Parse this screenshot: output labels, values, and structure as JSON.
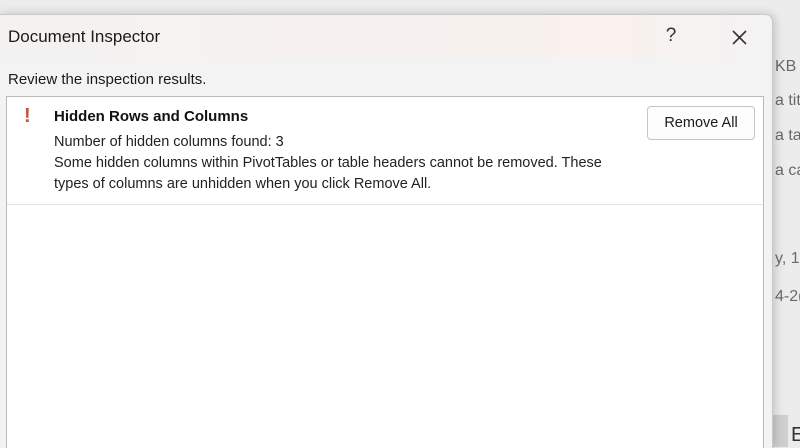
{
  "background": {
    "fragments": [
      "KB",
      "a tit",
      "a ta",
      "a ca",
      "y, 1",
      "4-2("
    ],
    "corner_glyph": "E"
  },
  "dialog": {
    "title": "Document Inspector",
    "help_label": "?",
    "close_icon": "close-icon",
    "subtitle": "Review the inspection results."
  },
  "results": {
    "items": [
      {
        "status_icon": "warning-exclamation-icon",
        "status_color": "#d1512b",
        "title": "Hidden Rows and Columns",
        "line1": "Number of hidden columns found: 3",
        "line2": "Some hidden columns within PivotTables or table headers cannot be removed. These",
        "line3": "types of columns are unhidden when you click Remove All.",
        "action_label": "Remove All"
      }
    ]
  }
}
